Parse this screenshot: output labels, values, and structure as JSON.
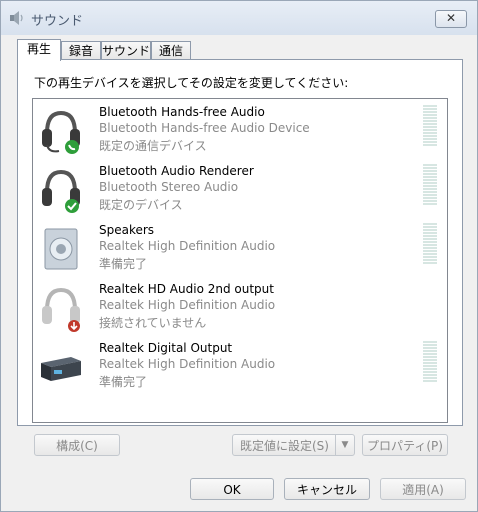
{
  "window": {
    "title": "サウンド",
    "close_label": "✕"
  },
  "tabs": [
    {
      "label": "再生",
      "active": true
    },
    {
      "label": "録音",
      "active": false
    },
    {
      "label": "サウンド",
      "active": false
    },
    {
      "label": "通信",
      "active": false
    }
  ],
  "instruction": "下の再生デバイスを選択してその設定を変更してください:",
  "devices": [
    {
      "name": "Bluetooth Hands-free Audio",
      "description": "Bluetooth Hands-free Audio Device",
      "status": "既定の通信デバイス",
      "icon": "headset-icon",
      "badge": "phone-badge-icon"
    },
    {
      "name": "Bluetooth Audio Renderer",
      "description": "Bluetooth Stereo Audio",
      "status": "既定のデバイス",
      "icon": "headphones-icon",
      "badge": "check-badge-icon"
    },
    {
      "name": "Speakers",
      "description": "Realtek High Definition Audio",
      "status": "準備完了",
      "icon": "speaker-icon",
      "badge": ""
    },
    {
      "name": "Realtek HD Audio 2nd output",
      "description": "Realtek High Definition Audio",
      "status": "接続されていません",
      "icon": "headphones-gray-icon",
      "badge": "unplugged-badge-icon"
    },
    {
      "name": "Realtek Digital Output",
      "description": "Realtek High Definition Audio",
      "status": "準備完了",
      "icon": "digital-receiver-icon",
      "badge": ""
    }
  ],
  "buttons": {
    "configure": "構成(C)",
    "set_default": "既定値に設定(S)",
    "properties": "プロパティ(P)",
    "ok": "OK",
    "cancel": "キャンセル",
    "apply": "適用(A)"
  },
  "colors": {
    "accent_green": "#2e9e3a",
    "unplugged_red": "#c0392b",
    "disabled_text": "#8a8a8a"
  }
}
